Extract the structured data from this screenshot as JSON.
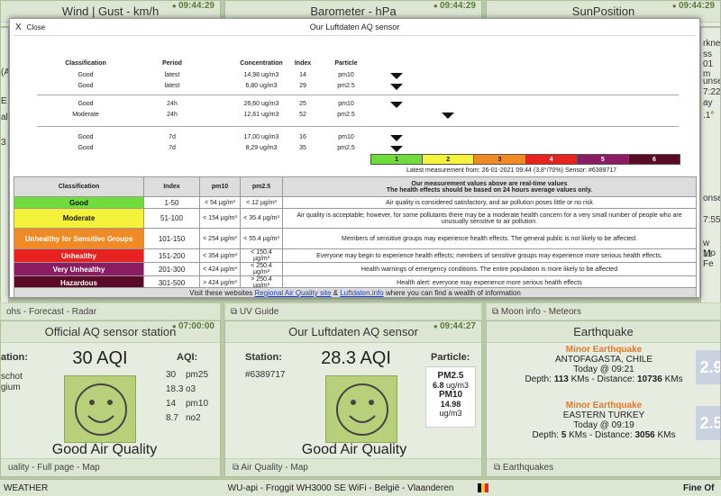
{
  "background": {
    "top_tiles": [
      {
        "title": "Wind | Gust - km/h",
        "time": "09:44:29"
      },
      {
        "title": "Barometer - hPa",
        "time": "09:44:29"
      },
      {
        "title": "SunPosition",
        "time": "09:44:29"
      }
    ],
    "left_fragments": [
      "(A",
      "E",
      "al",
      "3"
    ],
    "right_fragments": [
      "rkness",
      "ss 01 m",
      "unset",
      "7:22",
      "ay",
      ".1°",
      "onset",
      "7:55",
      "w Mo",
      "11 Fe"
    ],
    "mid_strips": [
      "ohs - Forecast - Radar",
      "UV Guide",
      "Moon info - Meteors"
    ],
    "aq_station": {
      "title": "Official AQ sensor station",
      "time": "07:00:00",
      "station_label": "ation:",
      "station_lines": [
        "schot",
        "gium"
      ],
      "aqi": "30 AQI",
      "aqi_label": "AQI:",
      "rows": [
        [
          "30",
          "pm25"
        ],
        [
          "18.3",
          "o3"
        ],
        [
          "14",
          "pm10"
        ],
        [
          "8.7",
          "no2"
        ]
      ],
      "quality": "Good Air Quality",
      "footer": "uality - Full page - Map"
    },
    "luft_sensor": {
      "title": "Our Luftdaten AQ sensor",
      "time": "09:44:27",
      "station_label": "Station:",
      "station_id": "#6389717",
      "aqi": "28.3 AQI",
      "particle_label": "Particle:",
      "pm25_label": "PM2.5",
      "pm25_value": "6.8",
      "pm10_label": "PM10",
      "pm10_value": "14.98",
      "unit": "ug/m3",
      "quality": "Good Air Quality",
      "footer": "Air Quality - Map"
    },
    "earthquake": {
      "title": "Earthquake",
      "items": [
        {
          "kind": "Minor Earthquake",
          "place": "ANTOFAGASTA, CHILE",
          "when": "Today @ 09:21",
          "depth_label": "Depth:",
          "depth": "113",
          "dist_label": "KMs - Distance:",
          "dist": "10736",
          "dist_unit": "KMs",
          "mag": "2.9"
        },
        {
          "kind": "Minor Earthquake",
          "place": "EASTERN TURKEY",
          "when": "Today @ 09:19",
          "depth_label": "Depth:",
          "depth": "5",
          "dist_label": "KMs - Distance:",
          "dist": "3056",
          "dist_unit": "KMs",
          "mag": "2.5"
        }
      ],
      "footer": "Earthquakes"
    },
    "bottom_bar": {
      "left": "WEATHER",
      "center": "WU-api  -  Froggit WH3000 SE WiFi  -  België - Vlaanderen",
      "right": "Fine Of"
    }
  },
  "modal": {
    "close_label": "Close",
    "title": "Our Luftdaten AQ sensor",
    "headers": [
      "Classification",
      "Period",
      "Concentration",
      "Index",
      "Particle"
    ],
    "groups": [
      [
        {
          "cls": "Good",
          "period": "latest",
          "conc": "14,98 ug/m3",
          "index": "14",
          "particle": "pm10",
          "marker": 1
        },
        {
          "cls": "Good",
          "period": "latest",
          "conc": "6,80 ug/m3",
          "index": "29",
          "particle": "pm2.5",
          "marker": 1
        }
      ],
      [
        {
          "cls": "Good",
          "period": "24h",
          "conc": "26,60 ug/m3",
          "index": "25",
          "particle": "pm10",
          "marker": 1
        },
        {
          "cls": "Moderate",
          "period": "24h",
          "conc": "12,61 ug/m3",
          "index": "52",
          "particle": "pm2.5",
          "marker": 2
        }
      ],
      [
        {
          "cls": "Good",
          "period": "7d",
          "conc": "17,00 ug/m3",
          "index": "16",
          "particle": "pm10",
          "marker": 1
        },
        {
          "cls": "Good",
          "period": "7d",
          "conc": "8,29 ug/m3",
          "index": "35",
          "particle": "pm2.5",
          "marker": 1
        }
      ]
    ],
    "scale": [
      {
        "label": "1",
        "color": "#6fdc3c"
      },
      {
        "label": "2",
        "color": "#f5f23a"
      },
      {
        "label": "3",
        "color": "#f08a24"
      },
      {
        "label": "4",
        "color": "#e8231f"
      },
      {
        "label": "5",
        "color": "#8b1c63"
      },
      {
        "label": "6",
        "color": "#5a0a26"
      }
    ],
    "measurement": "Latest measurement from: 26-01-2021 09:44   (3.8°/70%)   Sensor: #6389717",
    "class_table": {
      "headers": [
        "Classification",
        "Index",
        "pm10",
        "pm2.5"
      ],
      "note_line1": "Our measurement values above are real-time values",
      "note_line2": "The health effects should be based on 24 hours average values only.",
      "rows": [
        {
          "cls": "Good",
          "index": "1-50",
          "pm10": "< 54 µg/m³",
          "pm25": "< 12 µg/m³",
          "effect": "Air quality is considered satisfactory, and air pollution poses little or no risk",
          "bg": "#6fdc3c",
          "fg": "#111"
        },
        {
          "cls": "Moderate",
          "index": "51-100",
          "pm10": "< 154 µg/m³",
          "pm25": "< 35.4 µg/m³",
          "effect": "Air quality is acceptable; however, for some pollutants there may be a moderate health concern for a very small number of people who are unusually sensitive to air pollution.",
          "bg": "#f5f23a",
          "fg": "#111"
        },
        {
          "cls": "Unhealthy for Sensitive Groups",
          "index": "101-150",
          "pm10": "< 254 µg/m³",
          "pm25": "< 55.4 µg/m³",
          "effect": "Members of sensitive groups may experience health effects. The general public is not likely to be affected.",
          "bg": "#f08a24",
          "fg": "#fff"
        },
        {
          "cls": "Unhealthy",
          "index": "151-200",
          "pm10": "< 354 µg/m³",
          "pm25": "< 150.4 µg/m³",
          "effect": "Everyone may begin to experience health effects; members of sensitive groups may experience more serious health effects.",
          "bg": "#e8231f",
          "fg": "#fff"
        },
        {
          "cls": "Very Unhealthy",
          "index": "201-300",
          "pm10": "< 424 µg/m³",
          "pm25": "< 250.4 µg/m³",
          "effect": "Health warnings of emergency conditions. The entire population is more likely to be affected",
          "bg": "#8b1c63",
          "fg": "#fff"
        },
        {
          "cls": "Hazardous",
          "index": "301-500",
          "pm10": "> 424 µg/m³",
          "pm25": "> 250.4 µg/m³",
          "effect": "Health alert: everyone may experience more serious health effects",
          "bg": "#5a0a26",
          "fg": "#fff"
        }
      ]
    },
    "visit": {
      "pre": "Visit these websites ",
      "link1": "Regional Air Quality site",
      "mid": " & ",
      "link2": "Luftdaten.info",
      "post": " where you can find a wealth of information"
    }
  }
}
